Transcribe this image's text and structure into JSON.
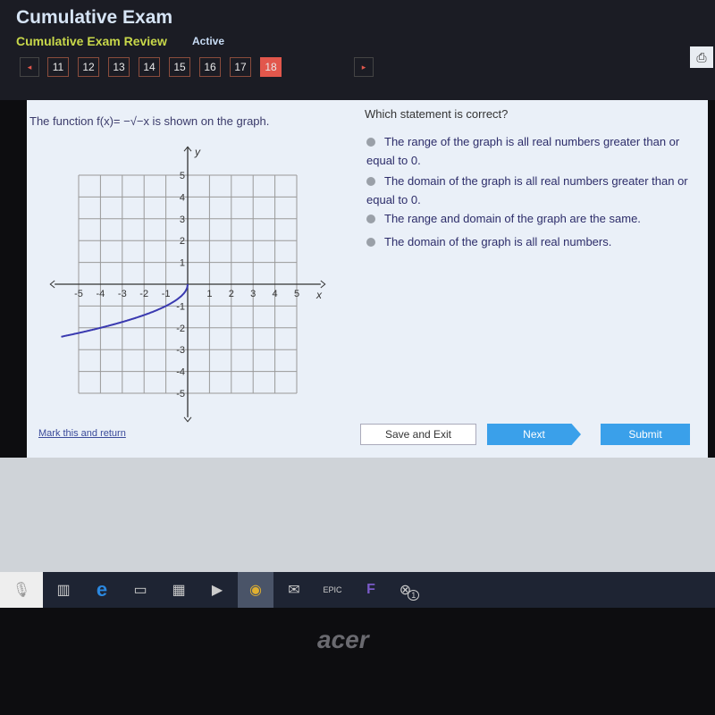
{
  "header": {
    "title": "Cumulative Exam",
    "subtitle": "Cumulative Exam Review",
    "status": "Active"
  },
  "nav": {
    "questions": [
      "11",
      "12",
      "13",
      "14",
      "15",
      "16",
      "17",
      "18"
    ],
    "current": "18",
    "prev_icon": "◂",
    "next_icon": "▸"
  },
  "question": {
    "prompt": "The function f(x)= −√−x is shown on the graph.",
    "ask": "Which statement is correct?",
    "options": [
      "The range of the graph is all real numbers greater than or equal to 0.",
      "The domain of the graph is all real numbers greater than or equal to 0.",
      "The range and domain of the graph are the same.",
      "The domain of the graph is all real numbers."
    ]
  },
  "graph": {
    "xlabel": "x",
    "ylabel": "y",
    "xticks": [
      "-5",
      "-4",
      "-3",
      "-2",
      "-1",
      "1",
      "2",
      "3",
      "4",
      "5"
    ],
    "yticks": [
      "5",
      "4",
      "3",
      "2",
      "1",
      "-1",
      "-2",
      "-3",
      "-4",
      "-5"
    ],
    "xlim": [
      -5,
      5
    ],
    "ylim": [
      -5,
      5
    ],
    "curve_color": "#3a3ab0"
  },
  "footer": {
    "mark": "Mark this and return",
    "save": "Save and Exit",
    "next": "Next",
    "submit": "Submit"
  },
  "taskbar": {
    "icons": [
      "microphone-icon",
      "task-view-icon",
      "edge-icon",
      "file-explorer-icon",
      "store-icon",
      "media-player-icon",
      "chrome-icon",
      "mail-icon",
      "epic-games-icon",
      "fortnite-icon",
      "xbox-icon"
    ],
    "xbox_badge": "1",
    "epic_label": "EPIC"
  },
  "monitor": {
    "brand": "acer"
  }
}
